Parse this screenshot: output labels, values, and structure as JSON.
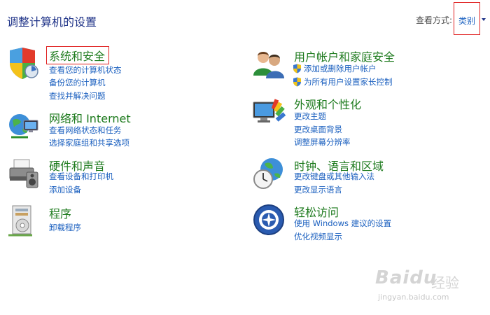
{
  "header": {
    "title": "调整计算机的设置",
    "view_by_label": "查看方式:",
    "view_mode": "类别"
  },
  "categories": {
    "system": {
      "icon": "shield-icon",
      "title": "系统和安全",
      "links": [
        "查看您的计算机状态",
        "备份您的计算机",
        "查找并解决问题"
      ]
    },
    "network": {
      "icon": "network-globe-icon",
      "title": "网络和 Internet",
      "links": [
        "查看网络状态和任务",
        "选择家庭组和共享选项"
      ]
    },
    "hardware": {
      "icon": "printer-icon",
      "title": "硬件和声音",
      "links": [
        "查看设备和打印机",
        "添加设备"
      ]
    },
    "programs": {
      "icon": "programs-icon",
      "title": "程序",
      "links": [
        "卸载程序"
      ]
    },
    "users": {
      "icon": "users-icon",
      "title": "用户帐户和家庭安全",
      "links": [
        "添加或删除用户帐户",
        "为所有用户设置家长控制"
      ]
    },
    "appearance": {
      "icon": "appearance-icon",
      "title": "外观和个性化",
      "links": [
        "更改主题",
        "更改桌面背景",
        "调整屏幕分辨率"
      ]
    },
    "clock": {
      "icon": "clock-globe-icon",
      "title": "时钟、语言和区域",
      "links": [
        "更改键盘或其他输入法",
        "更改显示语言"
      ]
    },
    "ease": {
      "icon": "ease-of-access-icon",
      "title": "轻松访问",
      "links": [
        "使用 Windows 建议的设置",
        "优化视频显示"
      ]
    }
  },
  "watermark": {
    "brand": "Baidu",
    "brand_cn": "经验",
    "url": "jingyan.baidu.com"
  }
}
